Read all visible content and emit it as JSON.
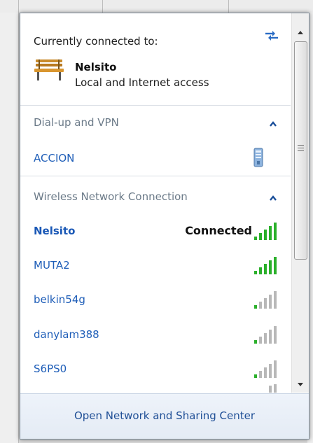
{
  "header": {
    "currently_connected_label": "Currently connected to:",
    "network_name": "Nelsito",
    "network_status": "Local and Internet access"
  },
  "dialup": {
    "title": "Dial-up and VPN",
    "items": [
      {
        "name": "ACCION",
        "icon": "vpn-connection-icon"
      }
    ]
  },
  "wireless": {
    "title": "Wireless Network Connection",
    "networks": [
      {
        "name": "Nelsito",
        "status": "Connected",
        "signal_bars": 5,
        "color": "green"
      },
      {
        "name": "MUTA2",
        "status": "",
        "signal_bars": 5,
        "color": "green"
      },
      {
        "name": "belkin54g",
        "status": "",
        "signal_bars": 1,
        "color": "green-gray"
      },
      {
        "name": "danylam388",
        "status": "",
        "signal_bars": 1,
        "color": "green-gray"
      },
      {
        "name": "S6PS0",
        "status": "",
        "signal_bars": 1,
        "color": "green-gray"
      }
    ]
  },
  "footer": {
    "link_text": "Open Network and Sharing Center"
  },
  "colors": {
    "link": "#1f5eb8",
    "section_title": "#6b7a88",
    "signal_green": "#2bb02b",
    "signal_gray": "#b8b8b8",
    "footer_bg": "#e9eff7"
  }
}
